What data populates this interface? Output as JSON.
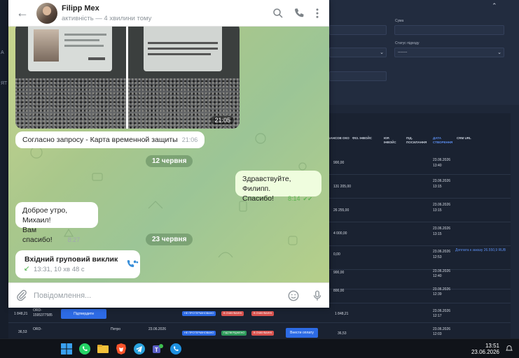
{
  "dashboard": {
    "left_nav": [
      "А",
      "ЯТ"
    ],
    "filters": {
      "sum_label": "Сума",
      "status_label": "Статус підходу",
      "status_value": "--------"
    },
    "table": {
      "headers": [
        "ІБАНСОВ ОКО",
        "ФІЗ. ІНВОЙС",
        "ЮР. ІНВОЙС",
        "ПІД. ПОСИЛАННЯ",
        "ДАТА СТВОРЕННЯ",
        "CRM URL"
      ],
      "rows": [
        {
          "amount": "900,00",
          "date": "23.06.2026",
          "time": "13:40",
          "note": ""
        },
        {
          "amount": "131 205,00",
          "date": "23.06.2026",
          "time": "13:15",
          "note": ""
        },
        {
          "amount": "26 255,00",
          "date": "23.06.2026",
          "time": "13:15",
          "note": ""
        },
        {
          "amount": "4 000,00",
          "date": "23.06.2026",
          "time": "13:15",
          "note": ""
        },
        {
          "amount": "0,00",
          "date": "23.06.2026",
          "time": "12:53",
          "note": "Доплата к заказу 26.550,9 RUB"
        },
        {
          "amount": "900,00",
          "date": "23.06.2026",
          "time": "12:40",
          "note": ""
        },
        {
          "amount": "800,00",
          "date": "23.06.2026",
          "time": "12:39",
          "note": ""
        },
        {
          "amount": "1 848,21",
          "date": "23.06.2026",
          "time": "12:17",
          "note": ""
        },
        {
          "amount": "36,53",
          "date": "23.06.2026",
          "time": "12:03",
          "note": ""
        }
      ],
      "bottom_rows": [
        {
          "left_amount": "1 848,21",
          "code": "ORD-1595377585",
          "button": "Підтвердити",
          "pill1": "НЕ ПРОТЕРМІНОВАНО",
          "pill2": "В ОЧІКУВАННІ",
          "pill3": "В ОЧІКУВАННІ"
        },
        {
          "left_amount": "36,53",
          "code": "ORD-",
          "name": "Петро",
          "date": "23.06.2026",
          "pill1": "НЕ ПРОТЕРМІНОВАНО",
          "pill2": "ПІДТВЕРДЖЕНО",
          "pill3": "В ОЧІКУВАННІ",
          "button": "Внести оплату"
        }
      ]
    }
  },
  "telegram": {
    "chat_name": "Filipp Mex",
    "chat_status": "активність — 4 хвилини тому",
    "photo_time": "21:05",
    "messages": [
      {
        "text": "Согласно запросу - Карта временной защиты",
        "time": "21:06"
      },
      {
        "date_chip": "12 червня"
      },
      {
        "text_line1": "Здравствуйте, Филипп.",
        "text_line2": "Спасибо!",
        "time": "8:14",
        "check": "✔✔"
      },
      {
        "text_line1": "Доброе утро, Михаил!",
        "text_line2": "Вам спасибо!",
        "time": "8:27"
      },
      {
        "date_chip": "23 червня"
      }
    ],
    "call": {
      "title": "Вхідний груповий виклик",
      "meta": "13:31, 10 хв 48 с"
    },
    "input_placeholder": "Повідомлення..."
  },
  "taskbar": {
    "time": "13:51",
    "date": "23.06.2026"
  },
  "colors": {
    "accent": "#3a8fd9",
    "outgoing_bubble": "#effdde",
    "chat_bg": "#a9c78b",
    "dashboard_bg": "#1e2738",
    "link": "#5b8ef0"
  }
}
